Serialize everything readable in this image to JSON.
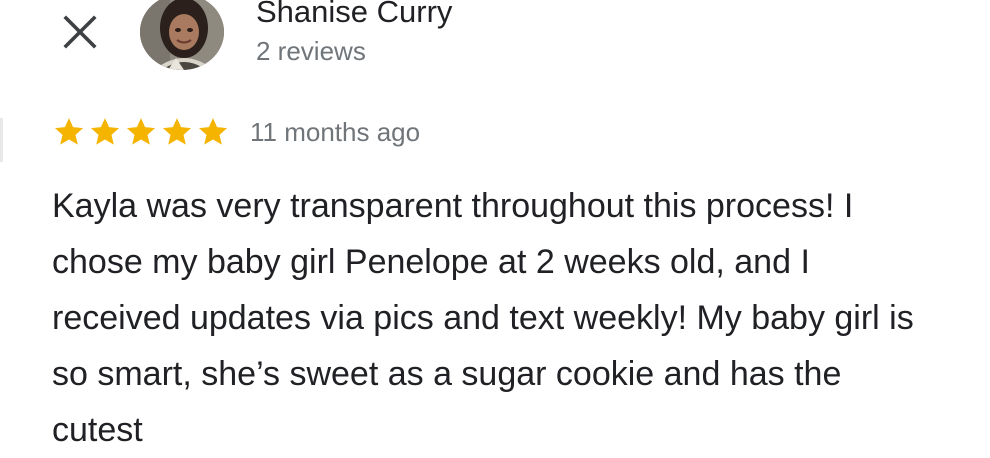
{
  "header": {
    "close_icon": "close-icon",
    "reviewer_name": "Shanise Curry",
    "review_count": "2 reviews"
  },
  "review": {
    "rating": 5,
    "max_rating": 5,
    "star_color": "#f4b400",
    "time": "11 months ago",
    "text": "Kayla was very transparent throughout this process! I chose my baby girl Penelope at 2 weeks old, and I received updates via pics and text weekly! My baby girl is so smart, she’s sweet as a sugar cookie and has the cutest"
  }
}
